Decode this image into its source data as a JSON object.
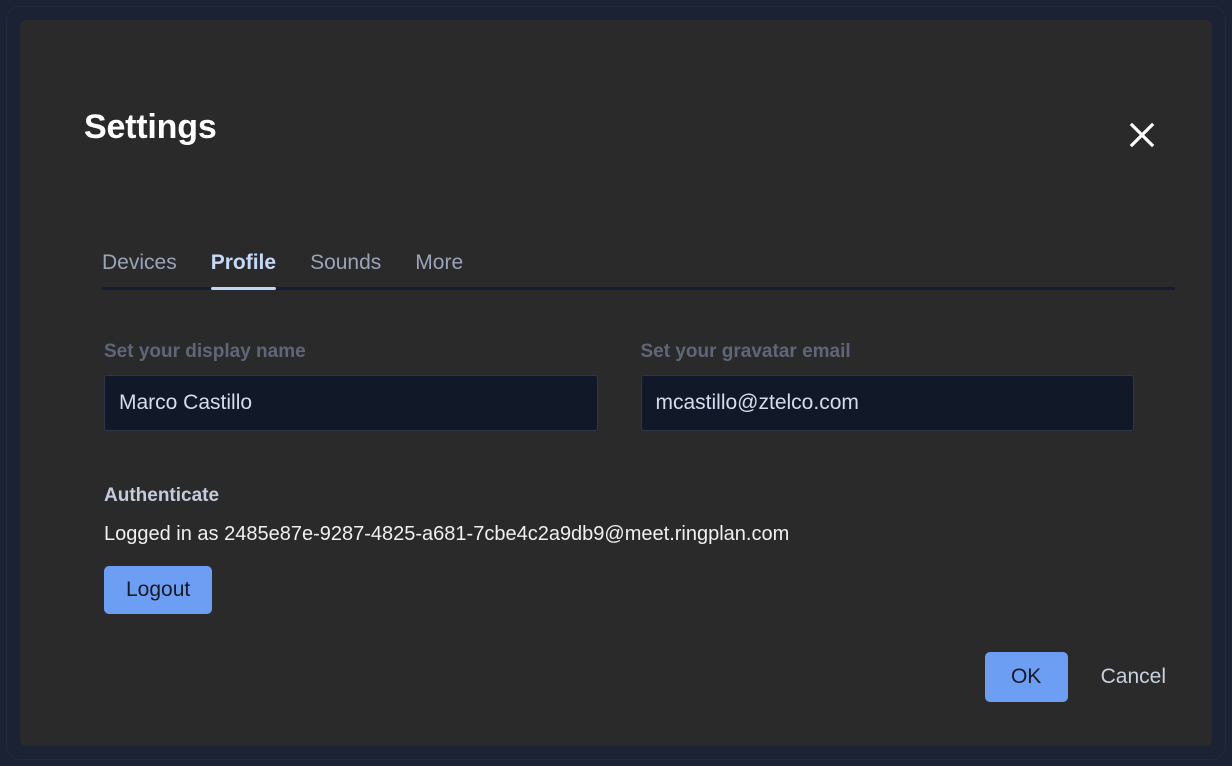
{
  "dialog": {
    "title": "Settings",
    "close_icon": "close-icon"
  },
  "tabs": [
    {
      "label": "Devices",
      "active": false
    },
    {
      "label": "Profile",
      "active": true
    },
    {
      "label": "Sounds",
      "active": false
    },
    {
      "label": "More",
      "active": false
    }
  ],
  "profile": {
    "display_name": {
      "label": "Set your display name",
      "value": "Marco Castillo",
      "placeholder": "Set your display name"
    },
    "gravatar_email": {
      "label": "Set your gravatar email",
      "value": "mcastillo@ztelco.com",
      "placeholder": "Set your gravatar email"
    }
  },
  "authenticate": {
    "heading": "Authenticate",
    "status": "Logged in as 2485e87e-9287-4825-a681-7cbe4c2a9db9@meet.ringplan.com",
    "logout_label": "Logout"
  },
  "footer": {
    "ok_label": "OK",
    "cancel_label": "Cancel"
  },
  "colors": {
    "accent": "#6c9ef3",
    "tab_active": "#bdd5f6",
    "dialog_bg": "#2a2a2a",
    "page_bg": "#1b2233",
    "input_bg": "#111827"
  }
}
